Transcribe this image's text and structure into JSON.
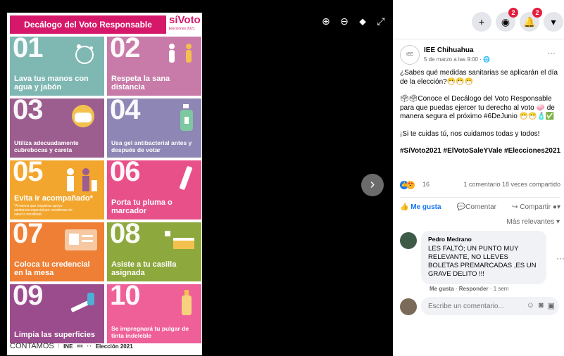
{
  "poster": {
    "title": "Decálogo del Voto Responsable",
    "logo": "síVoto",
    "logo_sub": "Elecciones 2021",
    "tiles": [
      {
        "num": "01",
        "text": "Lava tus manos con agua y jabón",
        "color": "#7fb8b3"
      },
      {
        "num": "02",
        "text": "Respeta la sana distancia",
        "color": "#c87ba8"
      },
      {
        "num": "03",
        "text": "Utiliza adecuadamente cubrebocas y careta",
        "color": "#9c5d8f"
      },
      {
        "num": "04",
        "text": "Usa gel antibacterial antes y después de votar",
        "color": "#8e86b4"
      },
      {
        "num": "05",
        "text": "Evita ir acompañado*",
        "note": "*A menos que requieras apoyo asistencia especial por cuestiones de salud o movilidad.",
        "color": "#f2a62e"
      },
      {
        "num": "06",
        "text": "Porta tu pluma o marcador",
        "color": "#e8508a"
      },
      {
        "num": "07",
        "text": "Coloca tu credencial en la mesa",
        "color": "#ee7f34"
      },
      {
        "num": "08",
        "text": "Asiste a tu casilla asignada",
        "color": "#8da83c"
      },
      {
        "num": "09",
        "text": "Limpia las superficies",
        "color": "#9b4c8c"
      },
      {
        "num": "10",
        "text": "Se impregnará tu pulgar de tinta indeleble",
        "color": "#ef5f98"
      }
    ],
    "footer": {
      "contamos": "CONTAMOS",
      "ine": "INE",
      "eleccion": "Elección 2021"
    }
  },
  "viewer": {
    "tools": {
      "zoom_in": "zoom-in-icon",
      "zoom_out": "zoom-out-icon",
      "tag": "tag-icon",
      "fullscreen": "fullscreen-icon"
    },
    "next_icon": "›"
  },
  "topbar": {
    "plus": "+",
    "messenger_badge": "2",
    "notif_badge": "2"
  },
  "post": {
    "page_name": "IEE Chihuahua",
    "date": "5 de marzo a las 9:00 · 🌐",
    "paragraphs": [
      "¿Sabes qué medidas sanitarias se aplicarán el día de la elección?😷😷😷",
      "🗳🗳Conoce el Decálogo del Voto Responsable para que puedas ejercer tu derecho al voto 🧼 de manera segura el próximo #6DeJunio 😷😷🧴✅",
      "¡Si te cuidas tú, nos cuidamos todas y todos!"
    ],
    "hashtags": "#SíVoto2021 #ElVotoSaleYVale #Elecciones2021",
    "reaction_count": "16",
    "stats": "1 comentario  18 veces compartido",
    "actions": {
      "like": "Me gusta",
      "comment": "Comentar",
      "share": "Compartir"
    },
    "sort": "Más relevantes ▾"
  },
  "comment": {
    "author": "Pedro Medrano",
    "text": "LES FALTÓ; UN PUNTO MUY RELEVANTE, NO LLEVES BOLETAS PREMARCADAS ,ES UN GRAVE DELITO !!!",
    "like": "Me gusta",
    "reply": "Responder",
    "time": "1 sem"
  },
  "composer": {
    "placeholder": "Escribe un comentario..."
  }
}
